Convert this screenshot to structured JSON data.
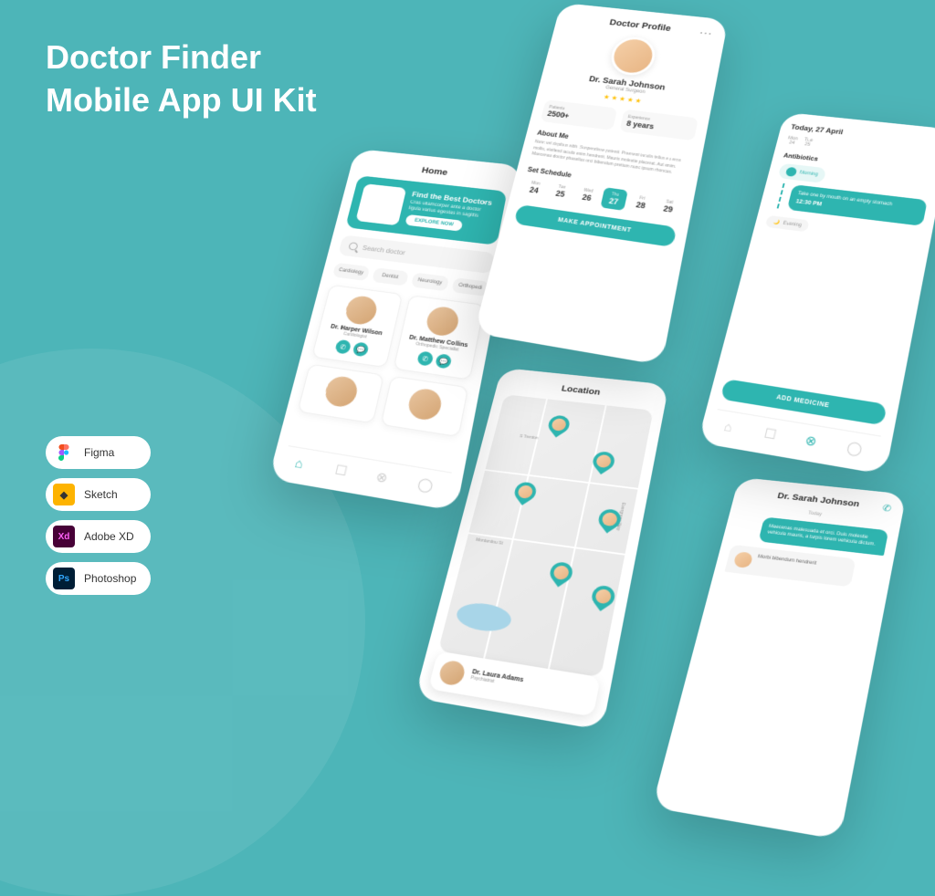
{
  "title_line1": "Doctor Finder",
  "title_line2": "Mobile App UI Kit",
  "tools": {
    "figma": "Figma",
    "sketch": "Sketch",
    "xd": "Adobe XD",
    "ps": "Photoshop"
  },
  "home": {
    "header": "Home",
    "hero_title": "Find the Best Doctors",
    "hero_desc": "Cras ullamcorper ante a doctor ligula varius egestas in sagittis",
    "hero_btn": "EXPLORE NOW",
    "search_placeholder": "Search doctor",
    "cat1": "Cardiology",
    "cat2": "Dentist",
    "cat3": "Neurology",
    "cat4": "Orthopedi",
    "doc1_name": "Dr. Harper Wilson",
    "doc1_spec": "Cardiologist",
    "doc2_name": "Dr. Matthew Collins",
    "doc2_spec": "Orthopedic Specialist"
  },
  "profile": {
    "header": "Doctor Profile",
    "name": "Dr. Sarah Johnson",
    "title": "General Surgeon",
    "patients_label": "Patients",
    "patients_value": "2500+",
    "experience_label": "Experience",
    "experience_value": "8 years",
    "about_title": "About Me",
    "about_text": "Nunc vel dapibus nibh. Suspendisse potenti. Praesent iaculis tellus eu eros mollis, eleifend iaculis enim hendrerit. Mauris molestie placerat. Aut enim. Maecenas doctor phasellus orci bibendum pretium nunc ipsum rhoncus.",
    "schedule_title": "Set Schedule",
    "days": [
      {
        "label": "Mon",
        "num": "24"
      },
      {
        "label": "Tue",
        "num": "25"
      },
      {
        "label": "Wed",
        "num": "26"
      },
      {
        "label": "Thu",
        "num": "27"
      },
      {
        "label": "Fri",
        "num": "28"
      },
      {
        "label": "Sat",
        "num": "29"
      }
    ],
    "btn": "MAKE APPOINTMENT"
  },
  "map": {
    "header": "Location",
    "street1": "S Trenton",
    "street2": "Montanitou St",
    "street3": "Evergreen Way",
    "doc_name": "Dr. Laura Adams",
    "doc_spec": "Psychiatrist"
  },
  "medicine": {
    "date": "Today, 27 April",
    "d1_label": "Mon",
    "d1_num": "24",
    "d2_label": "Tue",
    "d2_num": "25",
    "section": "Antibiotics",
    "morning": "Morning",
    "med_text": "Take one by mouth on an empty stomach",
    "med_time": "12:30 PM",
    "evening": "Evening",
    "btn": "ADD MEDICINE"
  },
  "chat": {
    "name": "Dr. Sarah Johnson",
    "today": "Today",
    "msg1": "Maecenas malesuada et orci. Duis molestie vehicula mauris, a turpis lorem vehicula dictum.",
    "msg2": "Morbi bibendum hendrerit"
  }
}
